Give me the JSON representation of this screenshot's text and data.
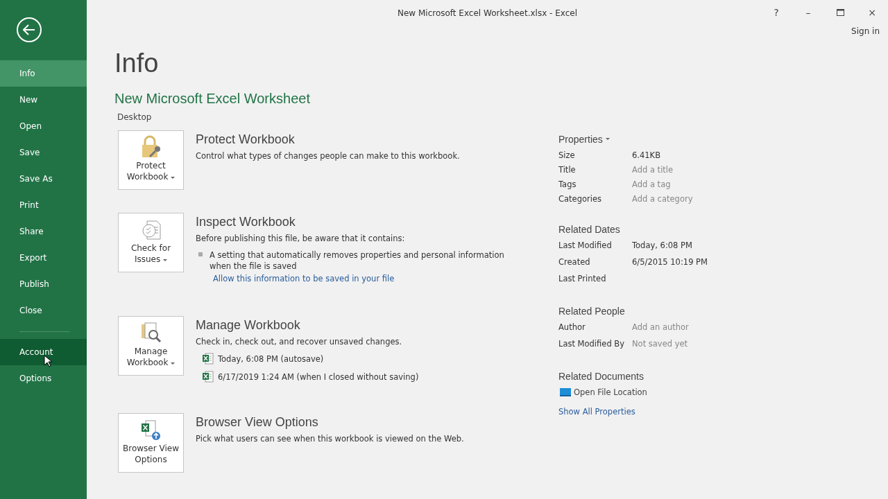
{
  "window": {
    "title": "New Microsoft Excel Worksheet.xlsx - Excel",
    "controls": [
      "?",
      "–",
      "×"
    ],
    "sign_in": "Sign in"
  },
  "sidebar": {
    "items": [
      {
        "label": "Info",
        "selected": true,
        "hovered": false
      },
      {
        "label": "New",
        "selected": false,
        "hovered": false
      },
      {
        "label": "Open",
        "selected": false,
        "hovered": false
      },
      {
        "label": "Save",
        "selected": false,
        "hovered": false
      },
      {
        "label": "Save As",
        "selected": false,
        "hovered": false
      },
      {
        "label": "Print",
        "selected": false,
        "hovered": false
      },
      {
        "label": "Share",
        "selected": false,
        "hovered": false
      },
      {
        "label": "Export",
        "selected": false,
        "hovered": false
      },
      {
        "label": "Publish",
        "selected": false,
        "hovered": false
      },
      {
        "label": "Close",
        "selected": false,
        "hovered": false
      }
    ],
    "lower_items": [
      {
        "label": "Account",
        "selected": false,
        "hovered": true
      },
      {
        "label": "Options",
        "selected": false,
        "hovered": false
      }
    ]
  },
  "page": {
    "title": "Info",
    "document": "New Microsoft Excel Worksheet",
    "location": "Desktop"
  },
  "sections": [
    {
      "kind": "protect",
      "button": [
        "Protect",
        "Workbook"
      ],
      "dropdown": true,
      "title": "Protect Workbook",
      "description": "Control what types of changes people can make to this workbook."
    },
    {
      "kind": "inspect",
      "button": [
        "Check for",
        "Issues"
      ],
      "dropdown": true,
      "title": "Inspect Workbook",
      "description": "Before publishing this file, be aware that it contains:",
      "bullets": [
        "A setting that automatically removes properties and personal information when the file is saved"
      ],
      "link": "Allow this information to be saved in your file"
    },
    {
      "kind": "manage",
      "button": [
        "Manage",
        "Workbook"
      ],
      "dropdown": true,
      "title": "Manage Workbook",
      "description": "Check in, check out, and recover unsaved changes.",
      "versions": [
        "Today, 6:08 PM (autosave)",
        "6/17/2019 1:24 AM (when I closed without saving)"
      ]
    },
    {
      "kind": "browser",
      "button": [
        "Browser View",
        "Options"
      ],
      "dropdown": false,
      "title": "Browser View Options",
      "description": "Pick what users can see when this workbook is viewed on the Web."
    }
  ],
  "properties": {
    "heading": "Properties",
    "rows": [
      {
        "label": "Size",
        "value": "6.41KB",
        "muted": false
      },
      {
        "label": "Title",
        "value": "Add a title",
        "muted": true
      },
      {
        "label": "Tags",
        "value": "Add a tag",
        "muted": true
      },
      {
        "label": "Categories",
        "value": "Add a category",
        "muted": true
      }
    ]
  },
  "related_dates": {
    "heading": "Related Dates",
    "rows": [
      {
        "label": "Last Modified",
        "value": "Today, 6:08 PM"
      },
      {
        "label": "Created",
        "value": "6/5/2015 10:19 PM"
      },
      {
        "label": "Last Printed"
      }
    ]
  },
  "related_people": {
    "heading": "Related People",
    "rows": [
      {
        "label": "Author",
        "value": "Add an author",
        "muted": true
      },
      {
        "label": "Last Modified By",
        "value": "Not saved yet",
        "muted": true
      }
    ]
  },
  "related_documents": {
    "heading": "Related Documents",
    "open_location": "Open File Location",
    "show_all": "Show All Properties"
  }
}
